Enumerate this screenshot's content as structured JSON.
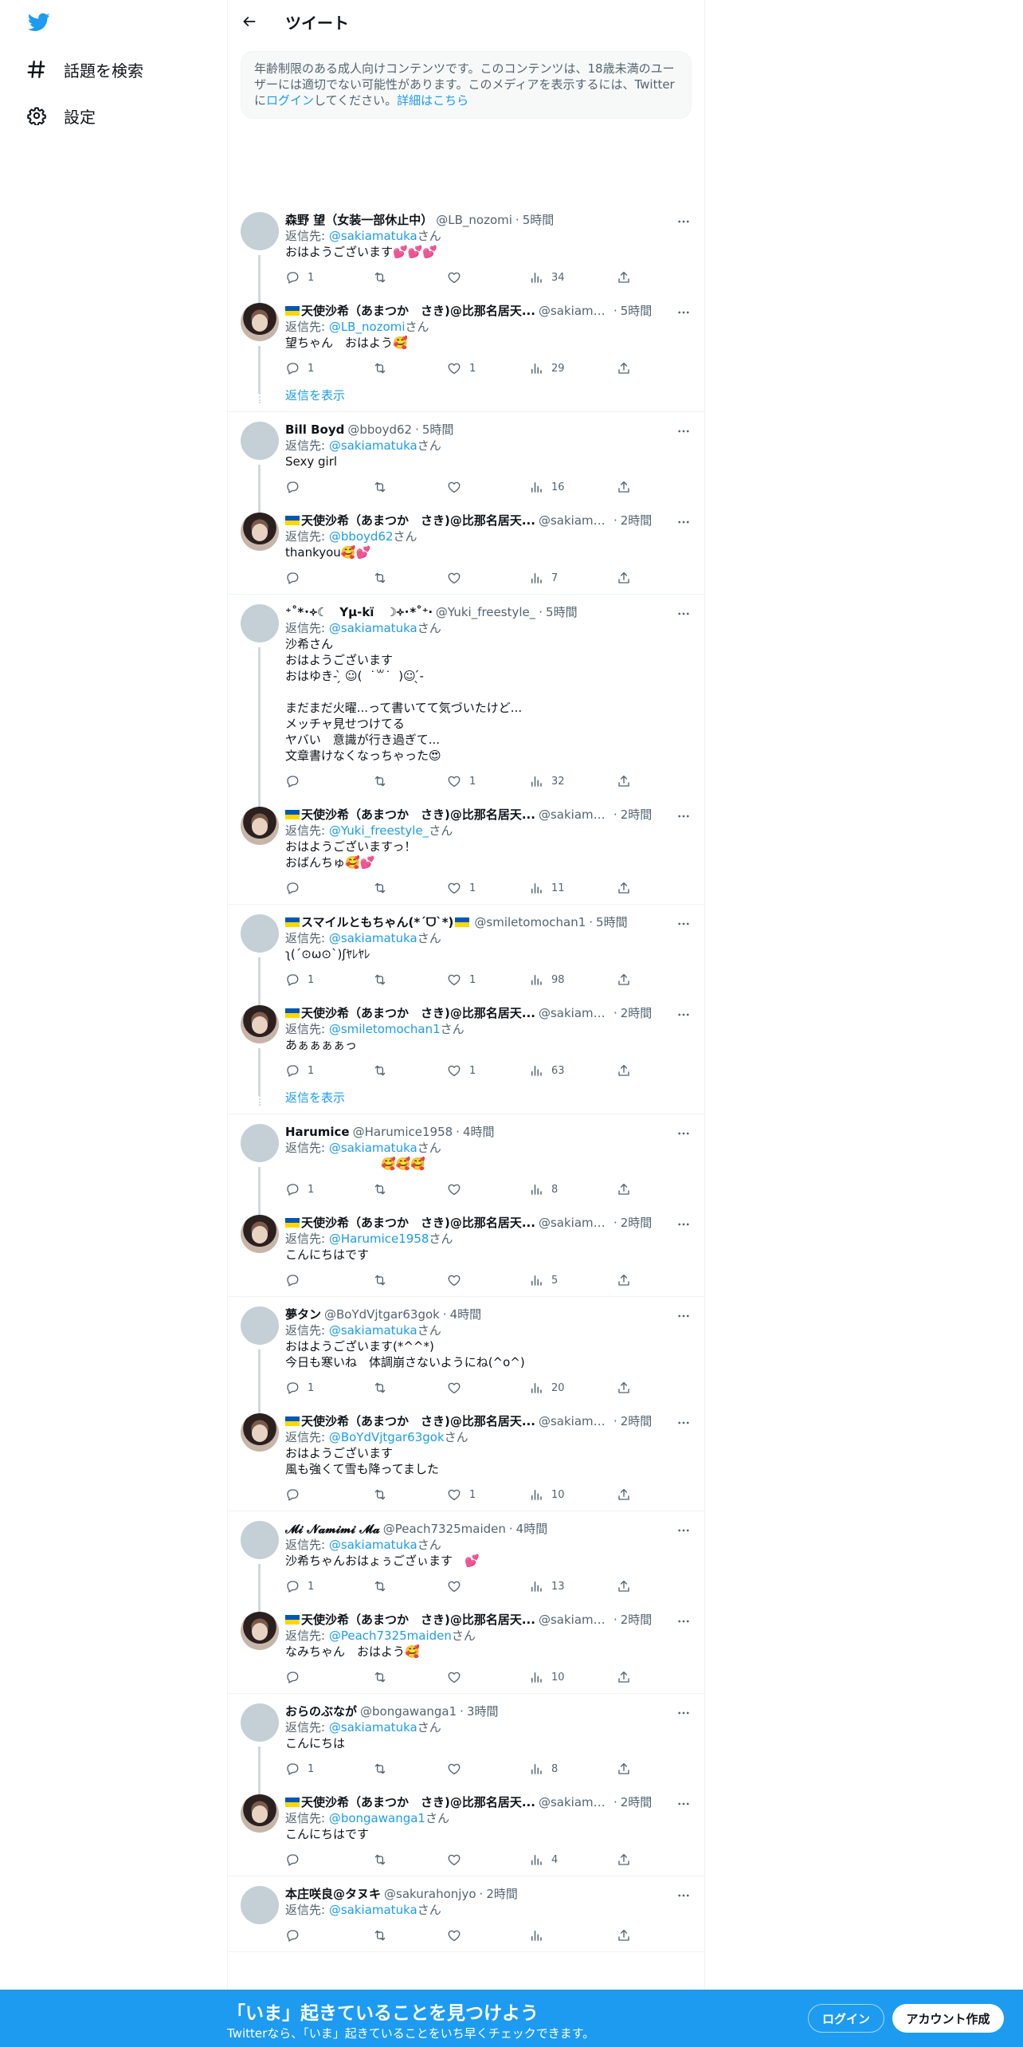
{
  "nav": {
    "explore_label": "話題を検索",
    "settings_label": "設定"
  },
  "header": {
    "title": "ツイート"
  },
  "notice": {
    "text": "年齢制限のある成人向けコンテンツです。このコンテンツは、18歳未満のユーザーには適切でない可能性があります。このメディアを表示するには、Twitterに",
    "login_link": "ログイン",
    "text2": "してください。",
    "details_link": "詳細はこちら"
  },
  "reply_to_prefix": "返信先: ",
  "reply_to_suffix": "さん",
  "show_replies_label": "返信を表示",
  "threads": [
    {
      "show_replies": true,
      "tweets": [
        {
          "name": "森野 望（女装一部休止中）",
          "handle": "@LB_nozomi",
          "time": "5時間",
          "reply_to": "@sakiamatuka",
          "text": "おはようございます💕💕💕",
          "replies": "1",
          "retweets": "",
          "likes": "",
          "views": "34",
          "avatar": "plain"
        },
        {
          "name": "天使沙希（あまつか　さき)@比那名居天...",
          "handle": "@sakiamat...",
          "time": "5時間",
          "reply_to": "@LB_nozomi",
          "text": "望ちゃん　おはよう🥰",
          "replies": "1",
          "retweets": "",
          "likes": "1",
          "views": "29",
          "avatar": "img",
          "flag": true
        }
      ]
    },
    {
      "show_replies": false,
      "tweets": [
        {
          "name": "Bill Boyd",
          "handle": "@bboyd62",
          "time": "5時間",
          "reply_to": "@sakiamatuka",
          "text": "Sexy girl",
          "replies": "",
          "retweets": "",
          "likes": "",
          "views": "16",
          "avatar": "plain"
        },
        {
          "name": "天使沙希（あまつか　さき)@比那名居天...",
          "handle": "@sakiamat...",
          "time": "2時間",
          "reply_to": "@bboyd62",
          "text": "thankyou🥰💕",
          "replies": "",
          "retweets": "",
          "likes": "",
          "views": "7",
          "avatar": "img",
          "flag": true
        }
      ]
    },
    {
      "show_replies": false,
      "tweets": [
        {
          "name": "⁺˚*･༓☾　Yμ-kï　☽༓･*˚⁺‧",
          "handle": "@Yuki_freestyle_",
          "time": "5時間",
          "reply_to": "@sakiamatuka",
          "text": "沙希さん\nおはようございます\nおはゆき- ̗̀ ☺︎(  ˙꒳˙  )☺︎ ̖́-\n\nまだまだ火曜...って書いてて気づいたけど...\nメッチャ見せつけてる\nヤバい　意識が行き過ぎて...\n文章書けなくなっちゃった😍",
          "replies": "",
          "retweets": "",
          "likes": "1",
          "views": "32",
          "avatar": "plain"
        },
        {
          "name": "天使沙希（あまつか　さき)@比那名居天...",
          "handle": "@sakiamat...",
          "time": "2時間",
          "reply_to": "@Yuki_freestyle_",
          "text": "おはようございますっ！\nおばんちゅ🥰💕",
          "replies": "",
          "retweets": "",
          "likes": "1",
          "views": "11",
          "avatar": "img",
          "flag": true
        }
      ]
    },
    {
      "show_replies": true,
      "tweets": [
        {
          "name": "スマイルともちゃん(*ˊᗜˋ*)",
          "handle": "@smiletomochan1",
          "time": "5時間",
          "reply_to": "@sakiamatuka",
          "text": "ʅ(´⊙ω⊙`)ʃﾔﾚﾔﾚ",
          "replies": "1",
          "retweets": "",
          "likes": "1",
          "views": "98",
          "avatar": "plain",
          "flag": true,
          "flag_after": true
        },
        {
          "name": "天使沙希（あまつか　さき)@比那名居天...",
          "handle": "@sakiamat...",
          "time": "2時間",
          "reply_to": "@smiletomochan1",
          "text": "あぁぁぁぁっ",
          "replies": "1",
          "retweets": "",
          "likes": "1",
          "views": "63",
          "avatar": "img",
          "flag": true
        }
      ]
    },
    {
      "show_replies": false,
      "tweets": [
        {
          "name": "Harumice",
          "handle": "@Harumice1958",
          "time": "4時間",
          "reply_to": "@sakiamatuka",
          "text": "　　　　　　　　🥰🥰🥰",
          "replies": "1",
          "retweets": "",
          "likes": "",
          "views": "8",
          "avatar": "plain"
        },
        {
          "name": "天使沙希（あまつか　さき)@比那名居天...",
          "handle": "@sakiamat...",
          "time": "2時間",
          "reply_to": "@Harumice1958",
          "text": "こんにちはです",
          "replies": "",
          "retweets": "",
          "likes": "",
          "views": "5",
          "avatar": "img",
          "flag": true
        }
      ]
    },
    {
      "show_replies": false,
      "tweets": [
        {
          "name": "夢タン",
          "handle": "@BoYdVjtgar63gok",
          "time": "4時間",
          "reply_to": "@sakiamatuka",
          "text": "おはようございます(*^^*)\n今日も寒いね　体調崩さないようにね(^o^)",
          "replies": "1",
          "retweets": "",
          "likes": "",
          "views": "20",
          "avatar": "plain"
        },
        {
          "name": "天使沙希（あまつか　さき)@比那名居天...",
          "handle": "@sakiamat...",
          "time": "2時間",
          "reply_to": "@BoYdVjtgar63gok",
          "text": "おはようございます\n風も強くて雪も降ってました",
          "replies": "",
          "retweets": "",
          "likes": "1",
          "views": "10",
          "avatar": "img",
          "flag": true
        }
      ]
    },
    {
      "show_replies": false,
      "tweets": [
        {
          "name": "𝓜𝓲 𝓝𝓪𝓶𝓲𝓶𝓲 𝓜𝓪",
          "handle": "@Peach7325maiden",
          "time": "4時間",
          "reply_to": "@sakiamatuka",
          "text": "沙希ちゃんおはょぅござぃます　💕",
          "replies": "1",
          "retweets": "",
          "likes": "",
          "views": "13",
          "avatar": "plain"
        },
        {
          "name": "天使沙希（あまつか　さき)@比那名居天...",
          "handle": "@sakiamat...",
          "time": "2時間",
          "reply_to": "@Peach7325maiden",
          "text": "なみちゃん　おはよう🥰",
          "replies": "",
          "retweets": "",
          "likes": "",
          "views": "10",
          "avatar": "img",
          "flag": true
        }
      ]
    },
    {
      "show_replies": false,
      "tweets": [
        {
          "name": "おらのぶなが",
          "handle": "@bongawanga1",
          "time": "3時間",
          "reply_to": "@sakiamatuka",
          "text": "こんにちは",
          "replies": "1",
          "retweets": "",
          "likes": "",
          "views": "8",
          "avatar": "plain"
        },
        {
          "name": "天使沙希（あまつか　さき)@比那名居天...",
          "handle": "@sakiamat...",
          "time": "2時間",
          "reply_to": "@bongawanga1",
          "text": "こんにちはです",
          "replies": "",
          "retweets": "",
          "likes": "",
          "views": "4",
          "avatar": "img",
          "flag": true
        }
      ]
    },
    {
      "show_replies": false,
      "tweets": [
        {
          "name": "本庄咲良@タヌキ",
          "handle": "@sakurahonjyo",
          "time": "2時間",
          "reply_to": "@sakiamatuka",
          "text": "",
          "replies": "",
          "retweets": "",
          "likes": "",
          "views": "",
          "avatar": "plain"
        }
      ]
    }
  ],
  "bottom_bar": {
    "title": "「いま」起きていることを見つけよう",
    "subtitle": "Twitterなら、「いま」起きていることをいち早くチェックできます。",
    "login_label": "ログイン",
    "signup_label": "アカウント作成"
  },
  "colors": {
    "accent": "#1d9bf0",
    "text": "#0f1419",
    "muted": "#536471",
    "border": "#eff3f4"
  }
}
